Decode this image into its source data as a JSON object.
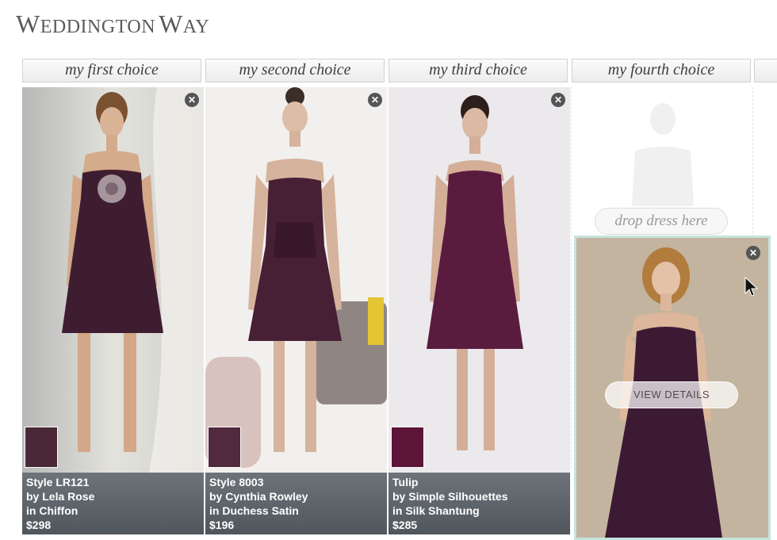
{
  "brand": {
    "logo_text": [
      "W",
      "EDDINGTON",
      "W",
      "AY"
    ]
  },
  "tabs": [
    "my first choice",
    "my second choice",
    "my third choice",
    "my fourth choice"
  ],
  "dresses": [
    {
      "style": "Style LR121",
      "designer": "by Lela Rose",
      "fabric": "in Chiffon",
      "price": "$298",
      "swatch_color": "#4a2838",
      "dress_color": "#3f1d31"
    },
    {
      "style": "Style 8003",
      "designer": "by Cynthia Rowley",
      "fabric": "in Duchess Satin",
      "price": "$196",
      "swatch_color": "#522a3d",
      "dress_color": "#472035"
    },
    {
      "style": "Tulip",
      "designer": "by Simple Silhouettes",
      "fabric": "in Silk Shantung",
      "price": "$285",
      "swatch_color": "#5c1538",
      "dress_color": "#5a1c3e"
    }
  ],
  "empty_slot": {
    "drop_label": "drop dress here"
  },
  "dragging_card": {
    "button_label": "VIEW DETAILS",
    "dress_color": "#3d1a33"
  },
  "icons": {
    "close": "close-icon",
    "cursor": "cursor-arrow-icon"
  }
}
